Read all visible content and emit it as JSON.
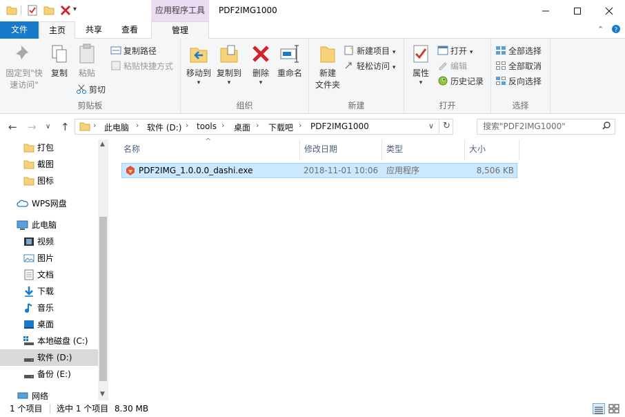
{
  "window": {
    "title": "PDF2IMG1000",
    "context_tab_group": "应用程序工具"
  },
  "tabs": {
    "file": "文件",
    "home": "主页",
    "share": "共享",
    "view": "查看",
    "manage": "管理"
  },
  "ribbon": {
    "clipboard": {
      "label": "剪贴板",
      "pin_line1": "固定到\"快",
      "pin_line2": "速访问\"",
      "copy": "复制",
      "paste": "粘贴",
      "copy_path": "复制路径",
      "paste_shortcut": "粘贴快捷方式",
      "cut": "剪切"
    },
    "organize": {
      "label": "组织",
      "move_to": "移动到",
      "copy_to": "复制到",
      "delete": "删除",
      "rename": "重命名"
    },
    "new": {
      "label": "新建",
      "new_folder_line1": "新建",
      "new_folder_line2": "文件夹",
      "new_item": "新建项目",
      "easy_access": "轻松访问"
    },
    "open": {
      "label": "打开",
      "properties": "属性",
      "open": "打开",
      "edit": "编辑",
      "history": "历史记录"
    },
    "select": {
      "label": "选择",
      "select_all": "全部选择",
      "select_none": "全部取消",
      "invert": "反向选择"
    }
  },
  "address": {
    "crumbs": [
      "此电脑",
      "软件 (D:)",
      "tools",
      "桌面",
      "下载吧",
      "PDF2IMG1000"
    ],
    "search_placeholder": "搜索\"PDF2IMG1000\""
  },
  "nav": {
    "quick": [
      "打包",
      "截图",
      "图标"
    ],
    "wps": "WPS网盘",
    "this_pc": "此电脑",
    "pc_items": [
      "视频",
      "图片",
      "文档",
      "下载",
      "音乐",
      "桌面",
      "本地磁盘 (C:)",
      "软件 (D:)",
      "备份 (E:)"
    ],
    "network": "网络"
  },
  "columns": {
    "name": "名称",
    "modified": "修改日期",
    "type": "类型",
    "size": "大小"
  },
  "files": [
    {
      "name": "PDF2IMG_1.0.0.0_dashi.exe",
      "modified": "2018-11-01 10:06",
      "type": "应用程序",
      "size": "8,506 KB"
    }
  ],
  "status": {
    "count": "1 个项目",
    "selected": "选中 1 个项目",
    "size": "8.30 MB"
  },
  "colors": {
    "accent": "#1979ca",
    "selection": "#cce8ff",
    "context_tab": "#eadcf3"
  }
}
